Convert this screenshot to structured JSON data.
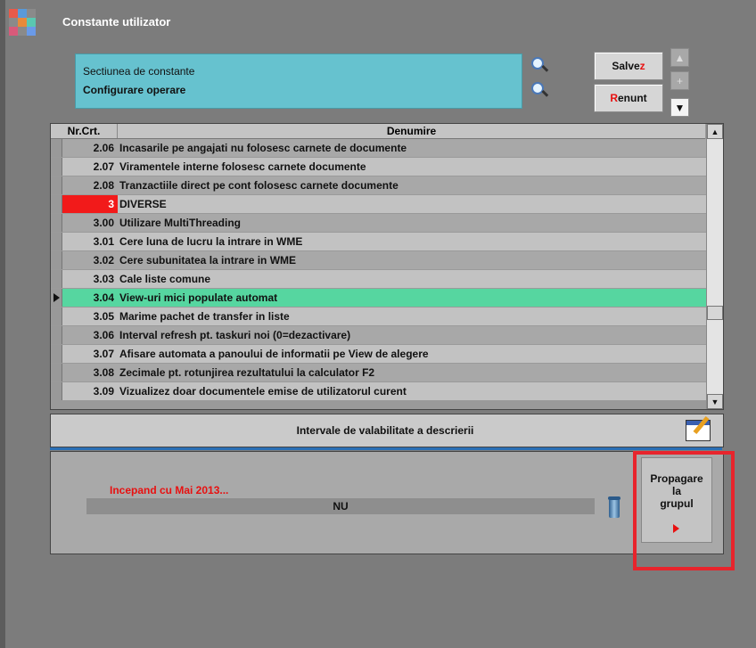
{
  "window": {
    "title": "Constante utilizator"
  },
  "section": {
    "caption": "Sectiunea de constante",
    "value": "Configurare operare"
  },
  "buttons": {
    "salvez_main": "Salve",
    "salvez_hot": "z",
    "renunt_hot": "R",
    "renunt_main": "enunt",
    "plus": "+",
    "up": "▲",
    "down": "▼"
  },
  "grid": {
    "columns": [
      "Nr.Crt.",
      "Denumire"
    ],
    "rows": [
      {
        "nr": "2.06",
        "den": "Incasarile pe angajati nu folosesc carnete de documente"
      },
      {
        "nr": "2.07",
        "den": "Viramentele interne folosesc carnete documente"
      },
      {
        "nr": "2.08",
        "den": "Tranzactiile direct pe cont folosesc carnete documente"
      },
      {
        "nr": "3",
        "den": "DIVERSE"
      },
      {
        "nr": "3.00",
        "den": "Utilizare MultiThreading"
      },
      {
        "nr": "3.01",
        "den": "Cere luna de lucru la intrare in WME"
      },
      {
        "nr": "3.02",
        "den": "Cere subunitatea la intrare in WME"
      },
      {
        "nr": "3.03",
        "den": "Cale liste comune"
      },
      {
        "nr": "3.04",
        "den": "View-uri mici populate automat"
      },
      {
        "nr": "3.05",
        "den": "Marime pachet de transfer in liste"
      },
      {
        "nr": "3.06",
        "den": "Interval refresh pt. taskuri noi (0=dezactivare)"
      },
      {
        "nr": "3.07",
        "den": "Afisare automata a panoului de informatii pe View de alegere"
      },
      {
        "nr": "3.08",
        "den": "Zecimale pt. rotunjirea rezultatului la calculator F2"
      },
      {
        "nr": "3.09",
        "den": "Vizualizez doar documentele emise de utilizatorul curent"
      }
    ],
    "selected_index": 8,
    "group_index": 3
  },
  "interval": {
    "label": "Intervale de valabilitate a descrierii"
  },
  "lower": {
    "incepand": "Incepand cu Mai 2013...",
    "value": "NU"
  },
  "propagare": {
    "line1": "Propagare",
    "line2": "la",
    "line3": "grupul"
  },
  "colors": {
    "teal": "#66c2cf",
    "selected_row": "#56d6a0",
    "group_red": "#f21a1a",
    "highlight": "#e8242c"
  }
}
